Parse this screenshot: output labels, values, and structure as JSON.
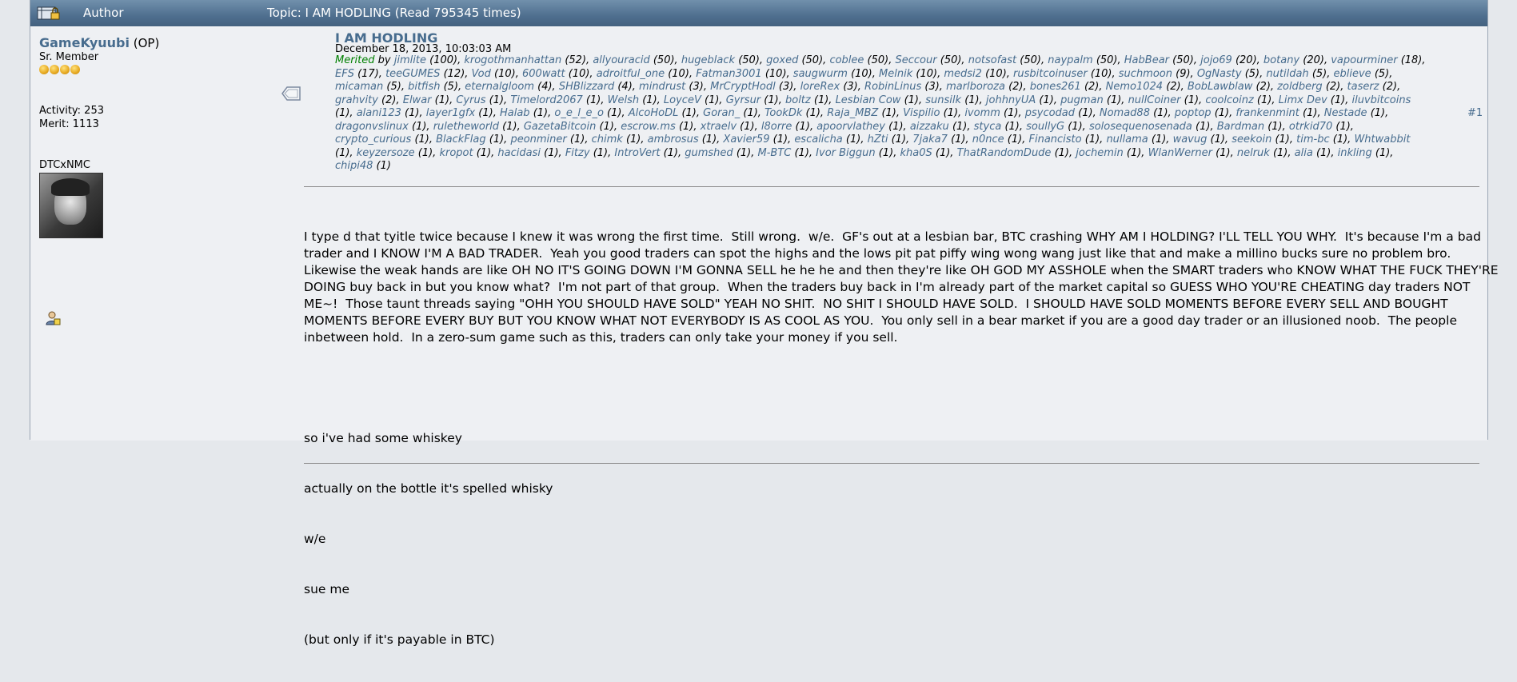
{
  "header": {
    "author_label": "Author",
    "topic_label": "Topic: I AM HODLING  (Read 795345 times)"
  },
  "poster": {
    "username": "GameKyuubi",
    "op": " (OP)",
    "rank": "Sr. Member",
    "star_count": 4,
    "activity": "Activity: 253",
    "merit": "Merit: 1113",
    "custom_title": "DTCxNMC"
  },
  "post": {
    "title": "I AM HODLING",
    "date": "December 18, 2013, 10:03:03 AM",
    "merited_label": "Merited",
    "merited_by": "by",
    "post_number": "#1",
    "merits": [
      {
        "u": "jimlite",
        "n": "(100)"
      },
      {
        "u": "krogothmanhattan",
        "n": "(52)"
      },
      {
        "u": "allyouracid",
        "n": "(50)"
      },
      {
        "u": "hugeblack",
        "n": "(50)"
      },
      {
        "u": "goxed",
        "n": "(50)"
      },
      {
        "u": "coblee",
        "n": "(50)"
      },
      {
        "u": "Seccour",
        "n": "(50)"
      },
      {
        "u": "notsofast",
        "n": "(50)"
      },
      {
        "u": "naypalm",
        "n": "(50)"
      },
      {
        "u": "HabBear",
        "n": "(50)"
      },
      {
        "u": "jojo69",
        "n": "(20)"
      },
      {
        "u": "botany",
        "n": "(20)"
      },
      {
        "u": "vapourminer",
        "n": "(18)"
      },
      {
        "u": "EFS",
        "n": "(17)"
      },
      {
        "u": "teeGUMES",
        "n": "(12)"
      },
      {
        "u": "Vod",
        "n": "(10)"
      },
      {
        "u": "600watt",
        "n": "(10)"
      },
      {
        "u": "adroitful_one",
        "n": "(10)"
      },
      {
        "u": "Fatman3001",
        "n": "(10)"
      },
      {
        "u": "saugwurm",
        "n": "(10)"
      },
      {
        "u": "Melnik",
        "n": "(10)"
      },
      {
        "u": "medsi2",
        "n": "(10)"
      },
      {
        "u": "rusbitcoinuser",
        "n": "(10)"
      },
      {
        "u": "suchmoon",
        "n": "(9)"
      },
      {
        "u": "OgNasty",
        "n": "(5)"
      },
      {
        "u": "nutildah",
        "n": "(5)"
      },
      {
        "u": "eblieve",
        "n": "(5)"
      },
      {
        "u": "micaman",
        "n": "(5)"
      },
      {
        "u": "bitfish",
        "n": "(5)"
      },
      {
        "u": "eternalgloom",
        "n": "(4)"
      },
      {
        "u": "SHBlizzard",
        "n": "(4)"
      },
      {
        "u": "mindrust",
        "n": "(3)"
      },
      {
        "u": "MrCryptHodl",
        "n": "(3)"
      },
      {
        "u": "loreRex",
        "n": "(3)"
      },
      {
        "u": "RobinLinus",
        "n": "(3)"
      },
      {
        "u": "marlboroza",
        "n": "(2)"
      },
      {
        "u": "bones261",
        "n": "(2)"
      },
      {
        "u": "Nemo1024",
        "n": "(2)"
      },
      {
        "u": "BobLawblaw",
        "n": ""
      },
      {
        "u": "",
        "n": "(2)"
      },
      {
        "u": "zoldberg",
        "n": "(2)"
      },
      {
        "u": "taserz",
        "n": "(2)"
      },
      {
        "u": "grahvity",
        "n": "(2)"
      },
      {
        "u": "Elwar",
        "n": "(1)"
      },
      {
        "u": "Cyrus",
        "n": "(1)"
      },
      {
        "u": "Timelord2067",
        "n": "(1)"
      },
      {
        "u": "Welsh",
        "n": "(1)"
      },
      {
        "u": "LoyceV",
        "n": "(1)"
      },
      {
        "u": "Gyrsur",
        "n": "(1)"
      },
      {
        "u": "boltz",
        "n": "(1)"
      },
      {
        "u": "Lesbian Cow",
        "n": "(1)"
      },
      {
        "u": "sunsilk",
        "n": "(1)"
      },
      {
        "u": "johhnyUA",
        "n": "(1)"
      },
      {
        "u": "pugman",
        "n": "(1)"
      },
      {
        "u": "nullCoiner",
        "n": "(1)"
      },
      {
        "u": "coolcoinz",
        "n": "(1)"
      },
      {
        "u": "Limx Dev",
        "n": "(1)"
      },
      {
        "u": "iluvbitcoins",
        "n": "(1)"
      },
      {
        "u": "alani123",
        "n": "(1)"
      },
      {
        "u": "layer1gfx",
        "n": "(1)"
      },
      {
        "u": "Halab",
        "n": "(1)"
      },
      {
        "u": "o_e_l_e_o",
        "n": "(1)"
      },
      {
        "u": "AlcoHoDL",
        "n": "(1)"
      },
      {
        "u": "Goran_",
        "n": "(1)"
      },
      {
        "u": "TookDk",
        "n": "(1)"
      },
      {
        "u": "Raja_MBZ",
        "n": "(1)"
      },
      {
        "u": "Vispilio",
        "n": "(1)"
      },
      {
        "u": "ivomm",
        "n": "(1)"
      },
      {
        "u": "psycodad",
        "n": "(1)"
      },
      {
        "u": "Nomad88",
        "n": "(1)"
      },
      {
        "u": "poptop",
        "n": "(1)"
      },
      {
        "u": "frankenmint",
        "n": "(1)"
      },
      {
        "u": "Nestade",
        "n": "(1)"
      },
      {
        "u": "dragonvslinux",
        "n": "(1)"
      },
      {
        "u": "ruletheworld",
        "n": "(1)"
      },
      {
        "u": "GazetaBitcoin",
        "n": "(1)"
      },
      {
        "u": "escrow.ms",
        "n": "(1)"
      },
      {
        "u": "xtraelv",
        "n": "(1)"
      },
      {
        "u": "l8orre",
        "n": "(1)"
      },
      {
        "u": "apoorvlathey",
        "n": "(1)"
      },
      {
        "u": "aizzaku",
        "n": "(1)"
      },
      {
        "u": "styca",
        "n": "(1)"
      },
      {
        "u": "soullyG",
        "n": "(1)"
      },
      {
        "u": "solosequenosenada",
        "n": "(1)"
      },
      {
        "u": "Bardman",
        "n": "(1)"
      },
      {
        "u": "otrkid70",
        "n": "(1)"
      },
      {
        "u": "crypto_curious",
        "n": "(1)"
      },
      {
        "u": "BlackFlag",
        "n": "(1)"
      },
      {
        "u": "peonminer",
        "n": "(1)"
      },
      {
        "u": "chimk",
        "n": "(1)"
      },
      {
        "u": "ambrosus",
        "n": "(1)"
      },
      {
        "u": "Xavier59",
        "n": "(1)"
      },
      {
        "u": "escalicha",
        "n": "(1)"
      },
      {
        "u": "hZti",
        "n": "(1)"
      },
      {
        "u": "7jaka7",
        "n": "(1)"
      },
      {
        "u": "n0nce",
        "n": "(1)"
      },
      {
        "u": "Financisto",
        "n": "(1)"
      },
      {
        "u": "nullama",
        "n": "(1)"
      },
      {
        "u": "wavug",
        "n": "(1)"
      },
      {
        "u": "seekoin",
        "n": "(1)"
      },
      {
        "u": "tim-bc",
        "n": "(1)"
      },
      {
        "u": "Whtwabbit",
        "n": "(1)"
      },
      {
        "u": "keyzersoze",
        "n": "(1)"
      },
      {
        "u": "kropot",
        "n": "(1)"
      },
      {
        "u": "hacidasi",
        "n": "(1)"
      },
      {
        "u": "Fitzy",
        "n": "(1)"
      },
      {
        "u": "IntroVert",
        "n": "(1)"
      },
      {
        "u": "gumshed",
        "n": "(1)"
      },
      {
        "u": "M-BTC",
        "n": "(1)"
      },
      {
        "u": "Ivor Biggun",
        "n": "(1)"
      },
      {
        "u": "kha0S",
        "n": "(1)"
      },
      {
        "u": "ThatRandomDude",
        "n": "(1)"
      },
      {
        "u": "jochemin",
        "n": "(1)"
      },
      {
        "u": "WlanWerner",
        "n": "(1)"
      },
      {
        "u": "nelruk",
        "n": "(1)"
      },
      {
        "u": "alia",
        "n": "(1)"
      },
      {
        "u": "inkling",
        "n": "(1)"
      },
      {
        "u": "chipi48",
        "n": "(1)"
      }
    ],
    "body_paragraph": "I type d that tyitle twice because I knew it was wrong the first time.  Still wrong.  w/e.  GF's out at a lesbian bar, BTC crashing WHY AM I HOLDING? I'LL TELL YOU WHY.  It's because I'm a bad trader and I KNOW I'M A BAD TRADER.  Yeah you good traders can spot the highs and the lows pit pat piffy wing wong wang just like that and make a millino bucks sure no problem bro.  Likewise the weak hands are like OH NO IT'S GOING DOWN I'M GONNA SELL he he he and then they're like OH GOD MY ASSHOLE when the SMART traders who KNOW WHAT THE FUCK THEY'RE DOING buy back in but you know what?  I'm not part of that group.  When the traders buy back in I'm already part of the market capital so GUESS WHO YOU'RE CHEATING day traders NOT ME~!  Those taunt threads saying \"OHH YOU SHOULD HAVE SOLD\" YEAH NO SHIT.  NO SHIT I SHOULD HAVE SOLD.  I SHOULD HAVE SOLD MOMENTS BEFORE EVERY SELL AND BOUGHT MOMENTS BEFORE EVERY BUY BUT YOU KNOW WHAT NOT EVERYBODY IS AS COOL AS YOU.  You only sell in a bear market if you are a good day trader or an illusioned noob.  The people inbetween hold.  In a zero-sum game such as this, traders can only take your money if you sell.",
    "body_lines": [
      "so i've had some whiskey",
      "actually on the bottle it's spelled whisky",
      "w/e",
      "sue me",
      "(but only if it's payable in BTC)"
    ]
  }
}
